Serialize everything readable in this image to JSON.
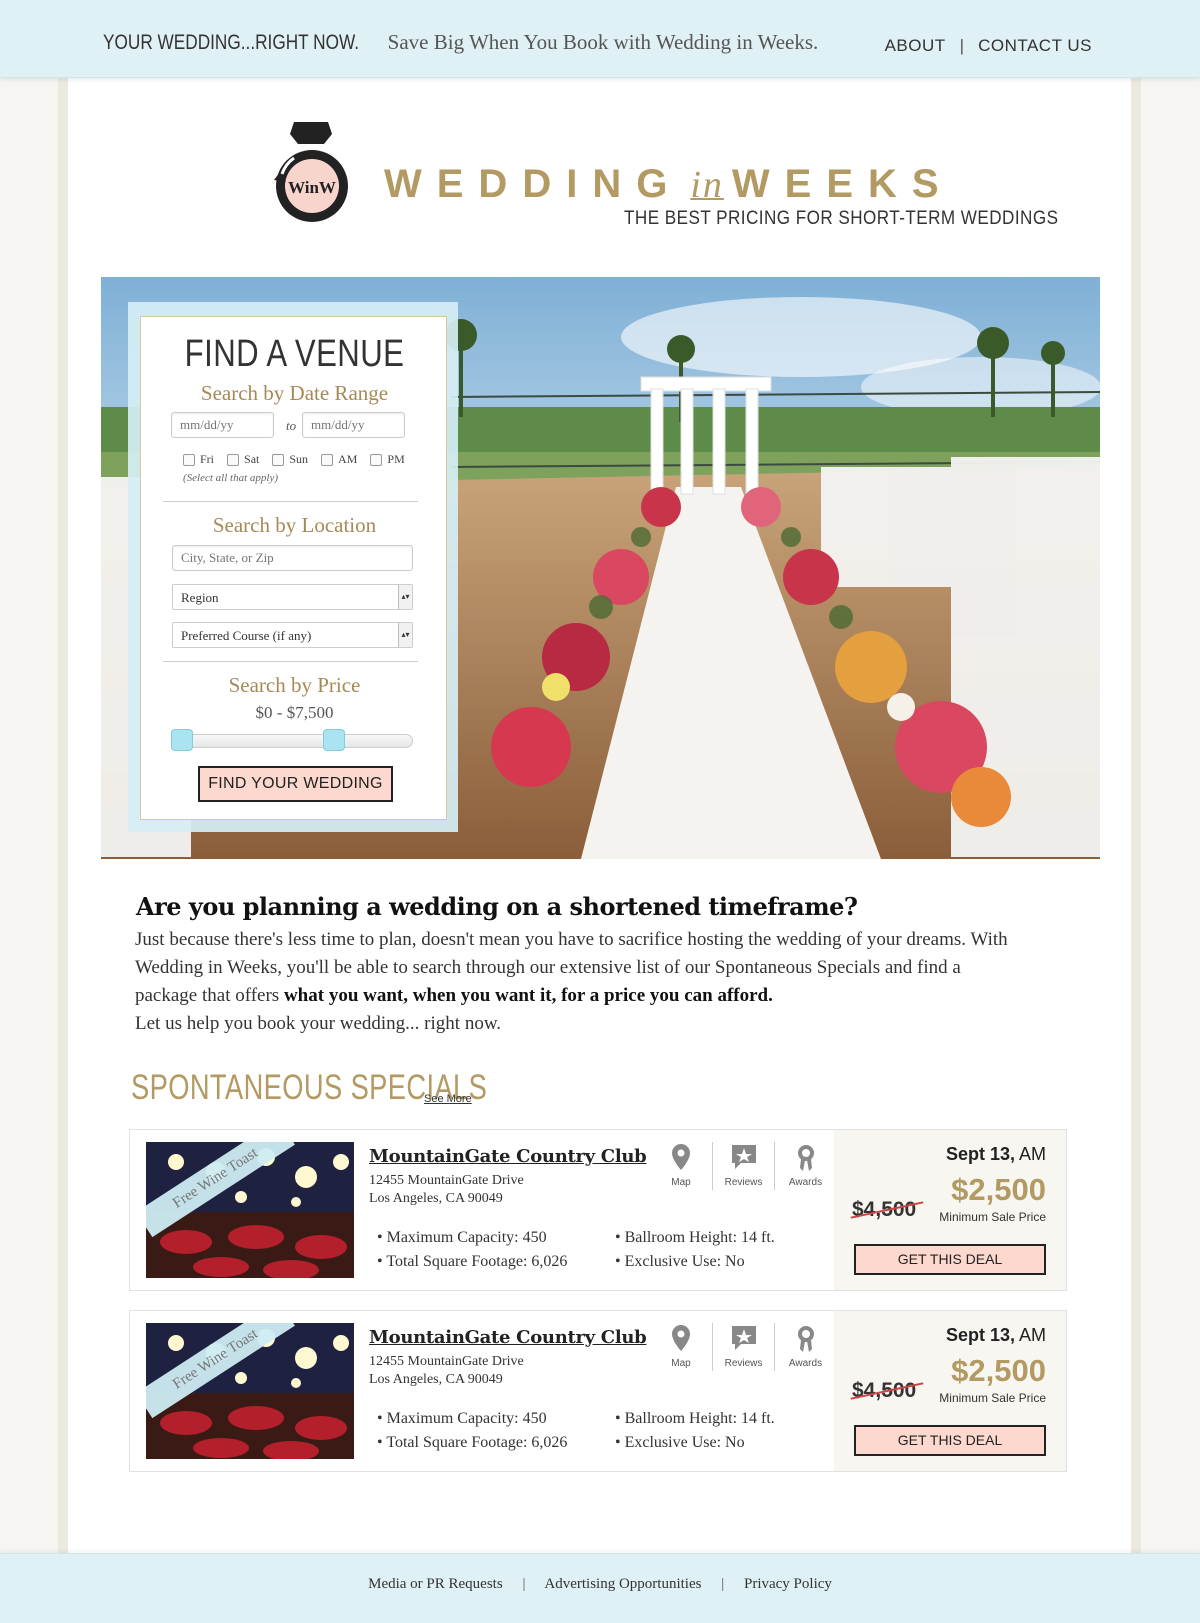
{
  "topbar": {
    "tagline_bold": "YOUR WEDDING...RIGHT NOW.",
    "tagline_rest": "Save Big When You Book with Wedding in Weeks.",
    "nav": [
      {
        "label": "ABOUT"
      },
      {
        "label": "CONTACT US"
      }
    ],
    "separator": "|"
  },
  "logo": {
    "monogram": "WinW",
    "brand_left": "WEDDING",
    "brand_mid": "in",
    "brand_right": "WEEKS",
    "subtitle": "THE BEST PRICING FOR SHORT-TERM WEDDINGS"
  },
  "finder": {
    "title": "FIND A VENUE",
    "date_section": "Search by Date Range",
    "date_from_placeholder": "mm/dd/yy",
    "date_to_placeholder": "mm/dd/yy",
    "to_label": "to",
    "day_options": [
      {
        "label": "Fri"
      },
      {
        "label": "Sat"
      },
      {
        "label": "Sun"
      },
      {
        "label": "AM"
      },
      {
        "label": "PM"
      }
    ],
    "hint": "(Select all that apply)",
    "location_section": "Search by Location",
    "location_placeholder": "City, State, or Zip",
    "region_select": "Region",
    "course_select": "Preferred Course (if any)",
    "price_section": "Search by Price",
    "price_range": "$0 - $7,500",
    "price_min_fraction": 0.0,
    "price_max_fraction": 0.69,
    "submit_label": "FIND YOUR WEDDING"
  },
  "intro": {
    "heading": "Are you planning a wedding on a shortened timeframe?",
    "body_start": "Just because there's less time to plan, doesn't mean you have to sacrifice hosting the wedding of your dreams. With Wedding in Weeks, you'll be able to search through our extensive list of our Spontaneous Specials and find a package that offers ",
    "body_bold": "what you want, when you want it, for a price you can afford.",
    "body_end": "Let us help you book your wedding... right now."
  },
  "specials": {
    "title": "SPONTANEOUS SPECIALS",
    "see_more": "See More",
    "cards": [
      {
        "ribbon": "Free Wine Toast",
        "name": "MountainGate Country Club",
        "address1": "12455 MountainGate Drive",
        "address2": "Los Angeles, CA 90049",
        "icons": [
          "Map",
          "Reviews",
          "Awards"
        ],
        "features": [
          "• Maximum Capacity: 450",
          "• Total Square Footage: 6,026",
          "• Ballroom Height: 14 ft.",
          "• Exclusive Use: No"
        ],
        "date_bold": "Sept 13,",
        "date_rest": " AM",
        "old_price": "$4,500",
        "new_price": "$2,500",
        "min_label": "Minimum Sale Price",
        "button": "GET THIS DEAL"
      },
      {
        "ribbon": "Free Wine Toast",
        "name": "MountainGate Country Club",
        "address1": "12455 MountainGate Drive",
        "address2": "Los Angeles, CA 90049",
        "icons": [
          "Map",
          "Reviews",
          "Awards"
        ],
        "features": [
          "• Maximum Capacity: 450",
          "• Total Square Footage: 6,026",
          "• Ballroom Height: 14 ft.",
          "• Exclusive Use: No"
        ],
        "date_bold": "Sept 13,",
        "date_rest": " AM",
        "old_price": "$4,500",
        "new_price": "$2,500",
        "min_label": "Minimum Sale Price",
        "button": "GET THIS DEAL"
      }
    ]
  },
  "footer": {
    "links": [
      {
        "label": "Media or PR Requests"
      },
      {
        "label": "Advertising Opportunities"
      },
      {
        "label": "Privacy Policy"
      }
    ],
    "separator": "|"
  },
  "colors": {
    "accent_gold": "#b29a62",
    "light_blue": "#dff1f4",
    "button_pink": "#fcd8cf"
  }
}
